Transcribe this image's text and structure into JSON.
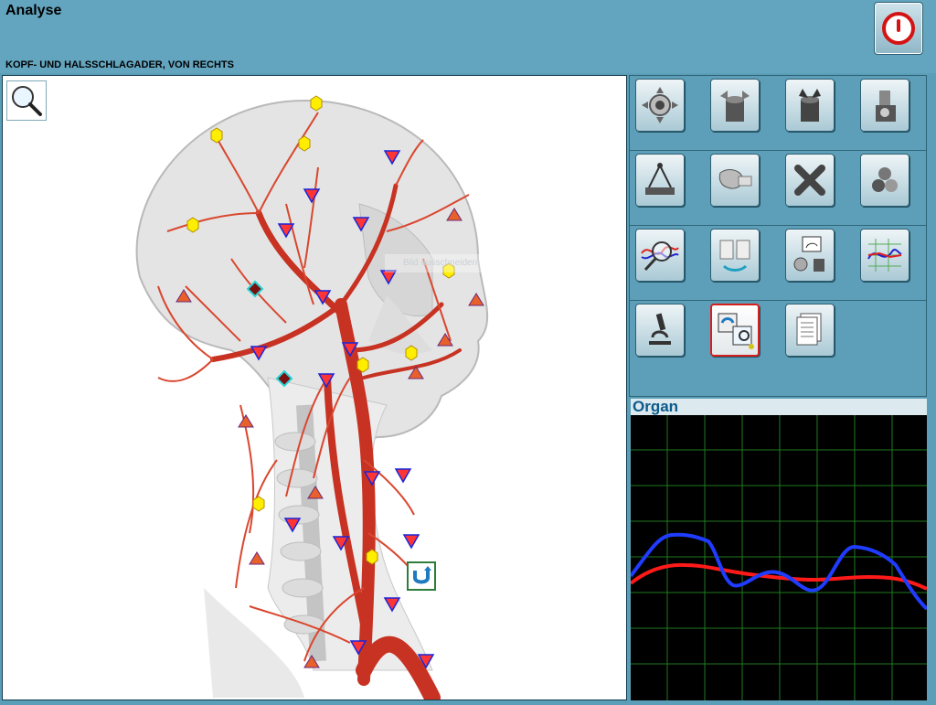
{
  "app": {
    "title": "Analyse",
    "subtitle": "KOPF- UND HALSSCHLAGADER, VON RECHTS",
    "power_icon": "power-icon"
  },
  "viewer": {
    "zoom_icon": "magnifier-icon",
    "faint_label": "Bild ausschneiden",
    "crop_icon": "undo-arrow-icon",
    "image_subject": "head-neck-arteries-right-side",
    "marker_colors": {
      "hexagon": "#ffee00",
      "triangle_down": "#ff3b3b",
      "triangle_up": "#e8602a",
      "diamond": "#7a1010"
    }
  },
  "tools": [
    [
      {
        "name": "target-crosshair-icon"
      },
      {
        "name": "cylinder-arrows-out-icon"
      },
      {
        "name": "cylinder-arrows-in-icon"
      },
      {
        "name": "stamp-icon"
      }
    ],
    [
      {
        "name": "scale-icon"
      },
      {
        "name": "organ-compare-icon"
      },
      {
        "name": "x-delete-icon"
      },
      {
        "name": "molecules-icon"
      }
    ],
    [
      {
        "name": "curve-magnifier-icon"
      },
      {
        "name": "refresh-books-icon"
      },
      {
        "name": "organ-tools-icon"
      },
      {
        "name": "graph-chart-icon"
      }
    ],
    [
      {
        "name": "microscope-icon"
      },
      {
        "name": "image-swap-icon",
        "selected": true
      },
      {
        "name": "document-icon"
      }
    ]
  ],
  "organ_panel": {
    "label": "Organ",
    "colors": {
      "blue": "#1f3cff",
      "red": "#ff1a1a",
      "grid": "#1f7a1f"
    }
  }
}
